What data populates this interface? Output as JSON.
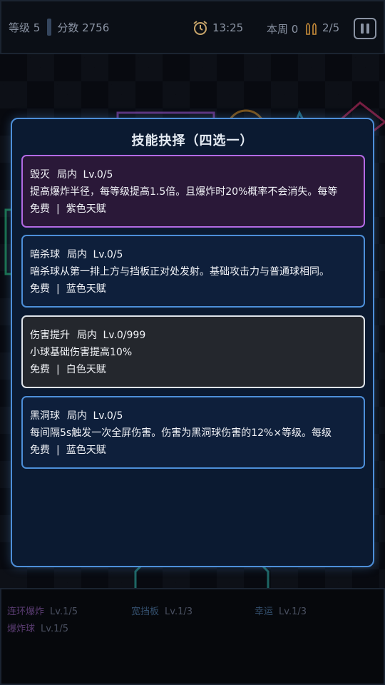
{
  "hud": {
    "level": "等级 5",
    "score": "分数 2756",
    "time": "13:25",
    "round": "本周 0",
    "ammo": "2/5"
  },
  "modal": {
    "title": "技能抉择（四选一）",
    "cards": [
      {
        "name": "毁灭",
        "scope": "局内",
        "level": "Lv.0/5",
        "desc": "提高爆炸半径，每等级提高1.5倍。且爆炸时20%概率不会消失。每等",
        "cost": "免费",
        "rarity": "紫色天赋",
        "color": "#b36ae4"
      },
      {
        "name": "暗杀球",
        "scope": "局内",
        "level": "Lv.0/5",
        "desc": "暗杀球从第一排上方与挡板正对处发射。基础攻击力与普通球相同。",
        "cost": "免费",
        "rarity": "蓝色天赋",
        "color": "#4d8fd9"
      },
      {
        "name": "伤害提升",
        "scope": "局内",
        "level": "Lv.0/999",
        "desc": "小球基础伤害提高10%",
        "cost": "免费",
        "rarity": "白色天赋",
        "color": "#dfe4ea"
      },
      {
        "name": "黑洞球",
        "scope": "局内",
        "level": "Lv.0/5",
        "desc": "每间隔5s触发一次全屏伤害。伤害为黑洞球伤害的12%×等级。每级",
        "cost": "免费",
        "rarity": "蓝色天赋",
        "color": "#4d8fd9"
      }
    ]
  },
  "talents": [
    {
      "name": "连环爆炸",
      "level": "Lv.1/5"
    },
    {
      "name": "宽挡板",
      "level": "Lv.1/3"
    },
    {
      "name": "幸运",
      "level": "Lv.1/3"
    },
    {
      "name": "爆炸球",
      "level": "Lv.1/5"
    }
  ],
  "icons": {
    "clock": "alarm-clock-icon",
    "ammo": "bullets-icon",
    "pause": "pause-icon"
  }
}
